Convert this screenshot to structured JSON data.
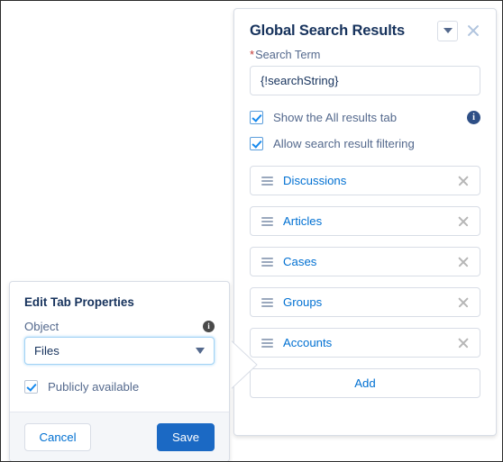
{
  "search_results_panel": {
    "title": "Global Search Results",
    "dropdown_icon": "chevron-down-icon",
    "close_icon": "close-icon",
    "search_term": {
      "label": "Search Term",
      "required_marker": "*",
      "value": "{!searchString}",
      "placeholder": ""
    },
    "checkboxes": [
      {
        "label": "Show the All results tab",
        "checked": true,
        "has_info": true
      },
      {
        "label": "Allow search result filtering",
        "checked": true,
        "has_info": false
      }
    ],
    "info_icon_glyph": "i",
    "tabs": [
      {
        "label": "Discussions"
      },
      {
        "label": "Articles"
      },
      {
        "label": "Cases"
      },
      {
        "label": "Groups"
      },
      {
        "label": "Accounts"
      }
    ],
    "add_label": "Add"
  },
  "edit_tab_properties": {
    "title": "Edit Tab Properties",
    "object_field": {
      "label": "Object",
      "value": "Files",
      "has_info": true
    },
    "publicly_available": {
      "label": "Publicly available",
      "checked": true
    },
    "cancel_label": "Cancel",
    "save_label": "Save"
  },
  "colors": {
    "link_blue": "#0070d2",
    "title_navy": "#16325c",
    "label_gray": "#54698d",
    "save_blue": "#1b69c4",
    "required_red": "#c23934",
    "border_gray": "#d8dde6",
    "focus_blue": "#a3d3f5",
    "info_navy": "#2e4f86"
  }
}
